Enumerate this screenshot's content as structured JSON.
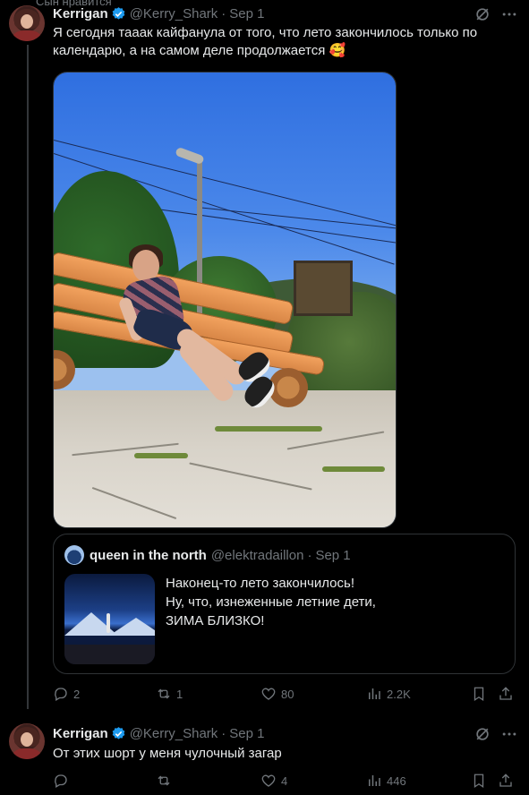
{
  "clipped_top_text": "Сын нравится",
  "tweets": [
    {
      "author": {
        "name": "Kerrigan",
        "handle": "@Kerry_Shark",
        "date": "Sep 1"
      },
      "text_line1": "Я сегодня тааак кайфанула от того, что лето закончилось только по",
      "text_line2": "календарю, а на самом деле продолжается 🥰",
      "quote": {
        "author": {
          "name": "queen in the north",
          "handle": "@elektradaillon",
          "date": "Sep 1"
        },
        "lines": [
          "Наконец-то лето закончилось!",
          "Ну, что, изнеженные летние дети,",
          "ЗИМА БЛИЗКО!"
        ]
      },
      "actions": {
        "replies": "2",
        "reposts": "1",
        "likes": "80",
        "views": "2.2K"
      }
    },
    {
      "author": {
        "name": "Kerrigan",
        "handle": "@Kerry_Shark",
        "date": "Sep 1"
      },
      "text_line1": "От этих шорт у меня чулочный загар",
      "actions": {
        "replies": "",
        "reposts": "",
        "likes": "4",
        "views": "446"
      }
    }
  ],
  "colors": {
    "background": "#000000",
    "text": "#e7e9ea",
    "muted": "#71767b",
    "verified": "#1d9bf0",
    "border": "#2f3336"
  },
  "icons": [
    "verified-badge-icon",
    "grok-icon",
    "more-icon",
    "reply-icon",
    "repost-icon",
    "like-icon",
    "views-icon",
    "bookmark-icon",
    "share-icon"
  ]
}
